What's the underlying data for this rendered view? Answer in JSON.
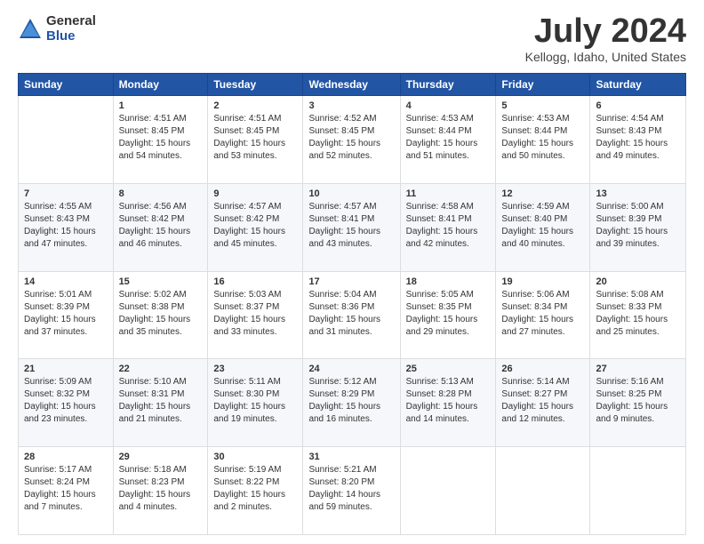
{
  "logo": {
    "general": "General",
    "blue": "Blue"
  },
  "title": "July 2024",
  "location": "Kellogg, Idaho, United States",
  "weekdays": [
    "Sunday",
    "Monday",
    "Tuesday",
    "Wednesday",
    "Thursday",
    "Friday",
    "Saturday"
  ],
  "weeks": [
    [
      {
        "num": "",
        "sunrise": "",
        "sunset": "",
        "daylight": ""
      },
      {
        "num": "1",
        "sunrise": "Sunrise: 4:51 AM",
        "sunset": "Sunset: 8:45 PM",
        "daylight": "Daylight: 15 hours and 54 minutes."
      },
      {
        "num": "2",
        "sunrise": "Sunrise: 4:51 AM",
        "sunset": "Sunset: 8:45 PM",
        "daylight": "Daylight: 15 hours and 53 minutes."
      },
      {
        "num": "3",
        "sunrise": "Sunrise: 4:52 AM",
        "sunset": "Sunset: 8:45 PM",
        "daylight": "Daylight: 15 hours and 52 minutes."
      },
      {
        "num": "4",
        "sunrise": "Sunrise: 4:53 AM",
        "sunset": "Sunset: 8:44 PM",
        "daylight": "Daylight: 15 hours and 51 minutes."
      },
      {
        "num": "5",
        "sunrise": "Sunrise: 4:53 AM",
        "sunset": "Sunset: 8:44 PM",
        "daylight": "Daylight: 15 hours and 50 minutes."
      },
      {
        "num": "6",
        "sunrise": "Sunrise: 4:54 AM",
        "sunset": "Sunset: 8:43 PM",
        "daylight": "Daylight: 15 hours and 49 minutes."
      }
    ],
    [
      {
        "num": "7",
        "sunrise": "Sunrise: 4:55 AM",
        "sunset": "Sunset: 8:43 PM",
        "daylight": "Daylight: 15 hours and 47 minutes."
      },
      {
        "num": "8",
        "sunrise": "Sunrise: 4:56 AM",
        "sunset": "Sunset: 8:42 PM",
        "daylight": "Daylight: 15 hours and 46 minutes."
      },
      {
        "num": "9",
        "sunrise": "Sunrise: 4:57 AM",
        "sunset": "Sunset: 8:42 PM",
        "daylight": "Daylight: 15 hours and 45 minutes."
      },
      {
        "num": "10",
        "sunrise": "Sunrise: 4:57 AM",
        "sunset": "Sunset: 8:41 PM",
        "daylight": "Daylight: 15 hours and 43 minutes."
      },
      {
        "num": "11",
        "sunrise": "Sunrise: 4:58 AM",
        "sunset": "Sunset: 8:41 PM",
        "daylight": "Daylight: 15 hours and 42 minutes."
      },
      {
        "num": "12",
        "sunrise": "Sunrise: 4:59 AM",
        "sunset": "Sunset: 8:40 PM",
        "daylight": "Daylight: 15 hours and 40 minutes."
      },
      {
        "num": "13",
        "sunrise": "Sunrise: 5:00 AM",
        "sunset": "Sunset: 8:39 PM",
        "daylight": "Daylight: 15 hours and 39 minutes."
      }
    ],
    [
      {
        "num": "14",
        "sunrise": "Sunrise: 5:01 AM",
        "sunset": "Sunset: 8:39 PM",
        "daylight": "Daylight: 15 hours and 37 minutes."
      },
      {
        "num": "15",
        "sunrise": "Sunrise: 5:02 AM",
        "sunset": "Sunset: 8:38 PM",
        "daylight": "Daylight: 15 hours and 35 minutes."
      },
      {
        "num": "16",
        "sunrise": "Sunrise: 5:03 AM",
        "sunset": "Sunset: 8:37 PM",
        "daylight": "Daylight: 15 hours and 33 minutes."
      },
      {
        "num": "17",
        "sunrise": "Sunrise: 5:04 AM",
        "sunset": "Sunset: 8:36 PM",
        "daylight": "Daylight: 15 hours and 31 minutes."
      },
      {
        "num": "18",
        "sunrise": "Sunrise: 5:05 AM",
        "sunset": "Sunset: 8:35 PM",
        "daylight": "Daylight: 15 hours and 29 minutes."
      },
      {
        "num": "19",
        "sunrise": "Sunrise: 5:06 AM",
        "sunset": "Sunset: 8:34 PM",
        "daylight": "Daylight: 15 hours and 27 minutes."
      },
      {
        "num": "20",
        "sunrise": "Sunrise: 5:08 AM",
        "sunset": "Sunset: 8:33 PM",
        "daylight": "Daylight: 15 hours and 25 minutes."
      }
    ],
    [
      {
        "num": "21",
        "sunrise": "Sunrise: 5:09 AM",
        "sunset": "Sunset: 8:32 PM",
        "daylight": "Daylight: 15 hours and 23 minutes."
      },
      {
        "num": "22",
        "sunrise": "Sunrise: 5:10 AM",
        "sunset": "Sunset: 8:31 PM",
        "daylight": "Daylight: 15 hours and 21 minutes."
      },
      {
        "num": "23",
        "sunrise": "Sunrise: 5:11 AM",
        "sunset": "Sunset: 8:30 PM",
        "daylight": "Daylight: 15 hours and 19 minutes."
      },
      {
        "num": "24",
        "sunrise": "Sunrise: 5:12 AM",
        "sunset": "Sunset: 8:29 PM",
        "daylight": "Daylight: 15 hours and 16 minutes."
      },
      {
        "num": "25",
        "sunrise": "Sunrise: 5:13 AM",
        "sunset": "Sunset: 8:28 PM",
        "daylight": "Daylight: 15 hours and 14 minutes."
      },
      {
        "num": "26",
        "sunrise": "Sunrise: 5:14 AM",
        "sunset": "Sunset: 8:27 PM",
        "daylight": "Daylight: 15 hours and 12 minutes."
      },
      {
        "num": "27",
        "sunrise": "Sunrise: 5:16 AM",
        "sunset": "Sunset: 8:25 PM",
        "daylight": "Daylight: 15 hours and 9 minutes."
      }
    ],
    [
      {
        "num": "28",
        "sunrise": "Sunrise: 5:17 AM",
        "sunset": "Sunset: 8:24 PM",
        "daylight": "Daylight: 15 hours and 7 minutes."
      },
      {
        "num": "29",
        "sunrise": "Sunrise: 5:18 AM",
        "sunset": "Sunset: 8:23 PM",
        "daylight": "Daylight: 15 hours and 4 minutes."
      },
      {
        "num": "30",
        "sunrise": "Sunrise: 5:19 AM",
        "sunset": "Sunset: 8:22 PM",
        "daylight": "Daylight: 15 hours and 2 minutes."
      },
      {
        "num": "31",
        "sunrise": "Sunrise: 5:21 AM",
        "sunset": "Sunset: 8:20 PM",
        "daylight": "Daylight: 14 hours and 59 minutes."
      },
      {
        "num": "",
        "sunrise": "",
        "sunset": "",
        "daylight": ""
      },
      {
        "num": "",
        "sunrise": "",
        "sunset": "",
        "daylight": ""
      },
      {
        "num": "",
        "sunrise": "",
        "sunset": "",
        "daylight": ""
      }
    ]
  ]
}
